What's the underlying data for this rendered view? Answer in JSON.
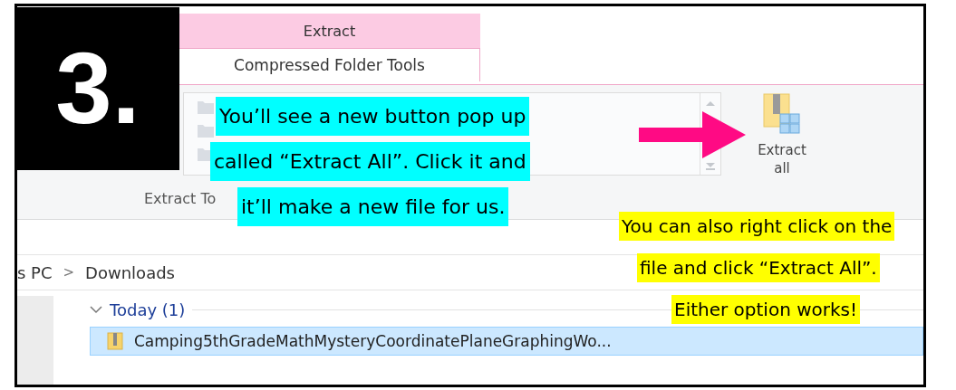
{
  "step_badge": "3.",
  "ribbon": {
    "context_header": "Extract",
    "active_tab": {
      "label": "Compressed Folder Tools",
      "selected": true
    },
    "group_label": "Extract To",
    "extract_button": "Extract all"
  },
  "breadcrumb": {
    "items": [
      "s PC",
      "Downloads"
    ],
    "separator": ">"
  },
  "file_list": {
    "group": {
      "label": "Today (1)",
      "expanded": true
    },
    "files": [
      {
        "name": "Camping5thGradeMathMysteryCoordinatePlaneGraphingWo...",
        "selected": true
      }
    ]
  },
  "callout": [
    "You’ll see a new button pop up",
    "called “Extract All”. Click it and",
    "it’ll make a new file for us."
  ],
  "note": [
    "You can also right click on the",
    "file and click “Extract All”.",
    "Either option works!"
  ]
}
